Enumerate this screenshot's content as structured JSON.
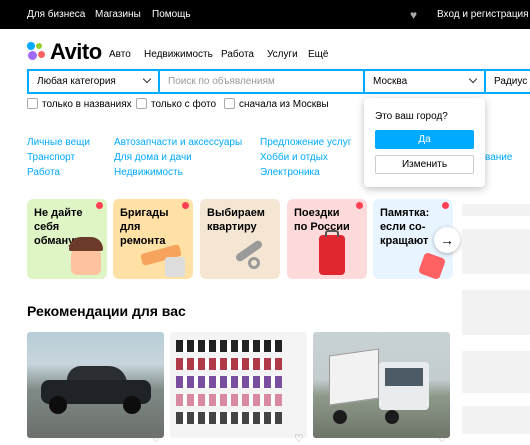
{
  "topbar": {
    "for_business": "Для бизнеса",
    "shops": "Магазины",
    "help": "Помощь",
    "login": "Вход и регистрация"
  },
  "header": {
    "logo": "Avito",
    "nav": [
      "Авто",
      "Недвижимость",
      "Работа",
      "Услуги",
      "Ещё"
    ]
  },
  "search": {
    "category": "Любая категория",
    "query_placeholder": "Поиск по объявлениям",
    "city": "Москва",
    "radius": "Радиус /"
  },
  "filters": [
    "только в названиях",
    "только с фото",
    "сначала из Москвы"
  ],
  "city_popup": {
    "question": "Это ваш город?",
    "yes": "Да",
    "change": "Изменить"
  },
  "categories": {
    "col1": [
      "Личные вещи",
      "Транспорт",
      "Работа"
    ],
    "col2": [
      "Автозапчасти и аксессуары",
      "Для дома и дачи",
      "Недвижимость"
    ],
    "col3": [
      "Предложение услуг",
      "Хобби и отдых",
      "Электроника"
    ],
    "partial": "вание"
  },
  "promos": [
    {
      "text": "Не дайте\nсебя\nобмануть",
      "bg": "#dff5c5"
    },
    {
      "text": "Бригады\nдля\nремонта",
      "bg": "#ffe1a6"
    },
    {
      "text": "Выбираем\nквартиру",
      "bg": "#f5e6d3"
    },
    {
      "text": "Поездки\nпо России",
      "bg": "#ffdada"
    },
    {
      "text": "Памятка:\nесли со-\nкращают",
      "bg": "#e8f4ff"
    }
  ],
  "recommendations_title": "Рекомендации для вас",
  "colors": {
    "accent": "#00aaff",
    "link": "#00aaff",
    "badge": "#ff4053"
  }
}
